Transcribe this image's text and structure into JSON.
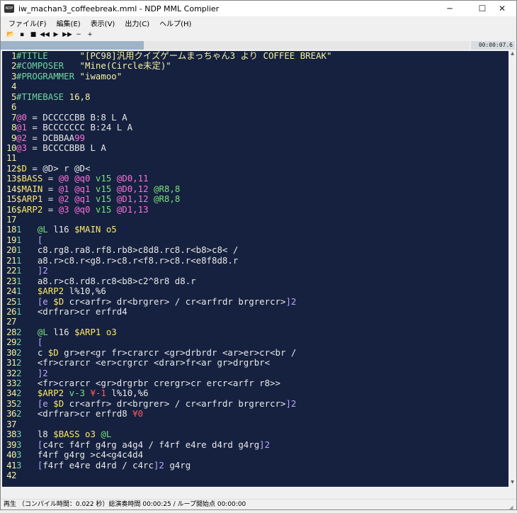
{
  "window": {
    "title": "iw_machan3_coffeebreak.mml - NDP MML Complier",
    "icon_label": "NDP",
    "controls": {
      "minimize": "─",
      "maximize": "☐",
      "close": "✕"
    }
  },
  "menu": [
    "ファイル(F)",
    "編集(E)",
    "表示(V)",
    "出力(C)",
    "ヘルプ(H)"
  ],
  "toolbar": [
    {
      "name": "open-icon",
      "glyph": "📂"
    },
    {
      "name": "save-icon",
      "glyph": "▪"
    },
    {
      "name": "stop-icon",
      "glyph": "■"
    },
    {
      "name": "rewind-icon",
      "glyph": "◀◀"
    },
    {
      "name": "play-icon",
      "glyph": "▶"
    },
    {
      "name": "fast-forward-icon",
      "glyph": "▶▶"
    },
    {
      "name": "minus-icon",
      "glyph": "−"
    },
    {
      "name": "plus-icon",
      "glyph": "+"
    }
  ],
  "playback": {
    "time": "00:00:07.6",
    "progress_fraction": 0.305
  },
  "code_lines": [
    [
      [
        "c-dir",
        "#TITLE      "
      ],
      [
        "c-str",
        "\"[PC98]汎用クイズゲームまっちゃん3 より COFFEE BREAK\""
      ]
    ],
    [
      [
        "c-dir",
        "#COMPOSER   "
      ],
      [
        "c-str",
        "\"Mine(Circle未定)\""
      ]
    ],
    [
      [
        "c-dir",
        "#PROGRAMMER "
      ],
      [
        "c-str",
        "\"iwamoo\""
      ]
    ],
    [],
    [
      [
        "c-dir",
        "#TIMEBASE "
      ],
      [
        "c-str",
        "16,8"
      ]
    ],
    [],
    [
      [
        "c-inst",
        "@0"
      ],
      [
        "c-wht",
        " = DCCCCCBB B:8 L A"
      ]
    ],
    [
      [
        "c-inst",
        "@1"
      ],
      [
        "c-wht",
        " = BCCCCCCC B:24 L A"
      ]
    ],
    [
      [
        "c-inst",
        "@2"
      ],
      [
        "c-wht",
        " = DCBBAA"
      ],
      [
        "c-inst",
        "99"
      ]
    ],
    [
      [
        "c-inst",
        "@3"
      ],
      [
        "c-wht",
        " = BCCCCBBB L A"
      ]
    ],
    [],
    [
      [
        "c-mac",
        "$D"
      ],
      [
        "c-wht",
        " = @D> r @D<"
      ]
    ],
    [
      [
        "c-mac",
        "$BASS"
      ],
      [
        "c-wht",
        " = "
      ],
      [
        "c-inst",
        "@0 @q0"
      ],
      [
        "c-grn",
        " v15"
      ],
      [
        "c-inst",
        " @D0,11"
      ]
    ],
    [
      [
        "c-mac",
        "$MAIN"
      ],
      [
        "c-wht",
        " = "
      ],
      [
        "c-inst",
        "@1 @q1"
      ],
      [
        "c-grn",
        " v15"
      ],
      [
        "c-inst",
        " @D0,12"
      ],
      [
        "c-grn",
        " @R8,8"
      ]
    ],
    [
      [
        "c-mac",
        "$ARP1"
      ],
      [
        "c-wht",
        " = "
      ],
      [
        "c-inst",
        "@2 @q1"
      ],
      [
        "c-grn",
        " v15"
      ],
      [
        "c-inst",
        " @D1,12"
      ],
      [
        "c-grn",
        " @R8,8"
      ]
    ],
    [
      [
        "c-mac",
        "$ARP2"
      ],
      [
        "c-wht",
        " = "
      ],
      [
        "c-inst",
        "@3 @q0"
      ],
      [
        "c-grn",
        " v15"
      ],
      [
        "c-inst",
        " @D1,13"
      ]
    ],
    [],
    [
      [
        "c-dir",
        "1   "
      ],
      [
        "c-grn",
        "@L"
      ],
      [
        "c-wht",
        " l16 "
      ],
      [
        "c-mac",
        "$MAIN"
      ],
      [
        "c-mac",
        " o5"
      ]
    ],
    [
      [
        "c-dir",
        "1   "
      ],
      [
        "c-brk",
        "["
      ]
    ],
    [
      [
        "c-dir",
        "1   "
      ],
      [
        "c-wht",
        "c8.rg8.ra8.rf8.rb8>c8d8.rc8.r<b8>c8< /"
      ]
    ],
    [
      [
        "c-dir",
        "1   "
      ],
      [
        "c-wht",
        "a8.r>c8.r<g8.r>c8.r<f8.r>c8.r<e8f8d8.r"
      ]
    ],
    [
      [
        "c-dir",
        "1   "
      ],
      [
        "c-brk",
        "]2"
      ]
    ],
    [
      [
        "c-dir",
        "1   "
      ],
      [
        "c-wht",
        "a8.r>c8.rd8.rc8<b8>c2^8r8 d8.r"
      ]
    ],
    [
      [
        "c-dir",
        "1   "
      ],
      [
        "c-mac",
        "$ARP2"
      ],
      [
        "c-wht",
        " l%10,%6"
      ]
    ],
    [
      [
        "c-dir",
        "1   "
      ],
      [
        "c-brk",
        "[e "
      ],
      [
        "c-mac",
        "$D"
      ],
      [
        "c-wht",
        " cr<arfr> dr<brgrer> / cr<arfrdr brgrercr>"
      ],
      [
        "c-brk",
        "]2"
      ]
    ],
    [
      [
        "c-dir",
        "1   "
      ],
      [
        "c-wht",
        "<drfrar>cr erfrd4"
      ]
    ],
    [],
    [
      [
        "c-dir",
        "2   "
      ],
      [
        "c-grn",
        "@L"
      ],
      [
        "c-wht",
        " l16 "
      ],
      [
        "c-mac",
        "$ARP1"
      ],
      [
        "c-mac",
        " o3"
      ]
    ],
    [
      [
        "c-dir",
        "2   "
      ],
      [
        "c-brk",
        "["
      ]
    ],
    [
      [
        "c-dir",
        "2   "
      ],
      [
        "c-wht",
        "c "
      ],
      [
        "c-mac",
        "$D"
      ],
      [
        "c-wht",
        " gr>er<gr fr>crarcr <gr>drbrdr <ar>er>cr<br /"
      ]
    ],
    [
      [
        "c-dir",
        "2   "
      ],
      [
        "c-wht",
        "<fr>crarcr <er>crgrcr <drar>fr<ar gr>drgrbr<"
      ]
    ],
    [
      [
        "c-dir",
        "2   "
      ],
      [
        "c-brk",
        "]2"
      ]
    ],
    [
      [
        "c-dir",
        "2   "
      ],
      [
        "c-wht",
        "<fr>crarcr <gr>drgrbr crergr>cr ercr<arfr r8>>"
      ]
    ],
    [
      [
        "c-dir",
        "2   "
      ],
      [
        "c-mac",
        "$ARP2"
      ],
      [
        "c-grn",
        " v-3 "
      ],
      [
        "c-red",
        "¥-1"
      ],
      [
        "c-wht",
        " l%10,%6"
      ]
    ],
    [
      [
        "c-dir",
        "2   "
      ],
      [
        "c-brk",
        "[e "
      ],
      [
        "c-mac",
        "$D"
      ],
      [
        "c-wht",
        " cr<arfr> dr<brgrer> / cr<arfrdr brgrercr>"
      ],
      [
        "c-brk",
        "]2"
      ]
    ],
    [
      [
        "c-dir",
        "2   "
      ],
      [
        "c-wht",
        "<drfrar>cr erfrd8 "
      ],
      [
        "c-red",
        "¥0"
      ]
    ],
    [],
    [
      [
        "c-dir",
        "3   "
      ],
      [
        "c-wht",
        "l8 "
      ],
      [
        "c-mac",
        "$BASS"
      ],
      [
        "c-mac",
        " o3"
      ],
      [
        "c-grn",
        " @L"
      ]
    ],
    [
      [
        "c-dir",
        "3   "
      ],
      [
        "c-brk",
        "["
      ],
      [
        "c-wht",
        "c4rc f4rf g4rg a4g4 / f4rf e4re d4rd g4rg"
      ],
      [
        "c-brk",
        "]2"
      ]
    ],
    [
      [
        "c-dir",
        "3   "
      ],
      [
        "c-wht",
        "f4rf g4rg >c4<g4c4d4"
      ]
    ],
    [
      [
        "c-dir",
        "3   "
      ],
      [
        "c-brk",
        "["
      ],
      [
        "c-wht",
        "f4rf e4re d4rd / c4rc"
      ],
      [
        "c-brk",
        "]2"
      ],
      [
        "c-wht",
        " g4rg"
      ]
    ],
    []
  ],
  "status": "再生 （コンパイル時間：0.022 秒）総演奏時間 00:00:25 / ループ開始点 00:00:00"
}
